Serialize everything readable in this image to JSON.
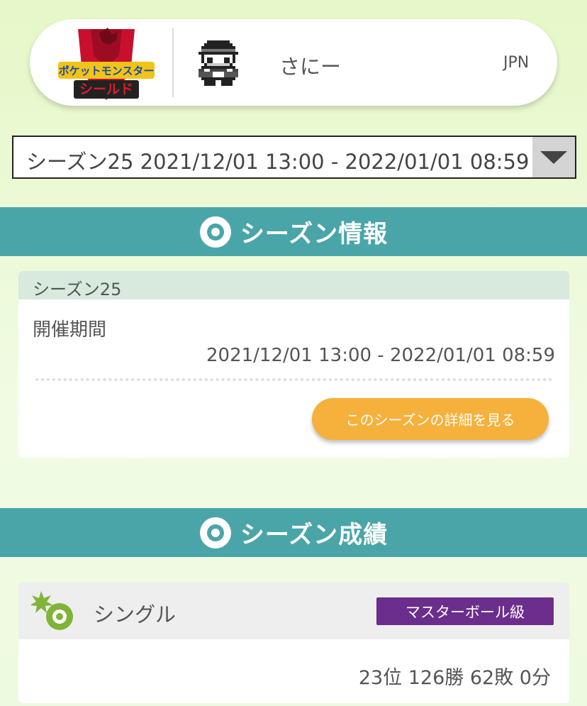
{
  "profile": {
    "game_logo": {
      "title_top": "ポケットモンスター",
      "title_bottom": "シールド"
    },
    "player_name": "さにー",
    "region": "JPN"
  },
  "season_select": {
    "selected": "シーズン25 2021/12/01 13:00 - 2022/01/01 08:59"
  },
  "season_info": {
    "header": "シーズン情報",
    "card_title": "シーズン25",
    "period_label": "開催期間",
    "period": "2021/12/01 13:00 - 2022/01/01 08:59",
    "detail_button": "このシーズンの詳細を見る"
  },
  "season_results": {
    "header": "シーズン成績",
    "battle_type": "シングル",
    "rank_class": "マスターボール級",
    "stats": "23位 126勝 62敗 0分"
  },
  "colors": {
    "section_header": "#4aa5a9",
    "button": "#f5b13b",
    "rank_badge": "#6b2e8c",
    "logo_red": "#c8102e",
    "icon_green": "#7fb439"
  },
  "icons": {
    "section": "pokeball-icon",
    "avatar": "trainer-pixel-avatar",
    "battle": "single-battle-icon",
    "dropdown": "triangle-down-icon"
  }
}
